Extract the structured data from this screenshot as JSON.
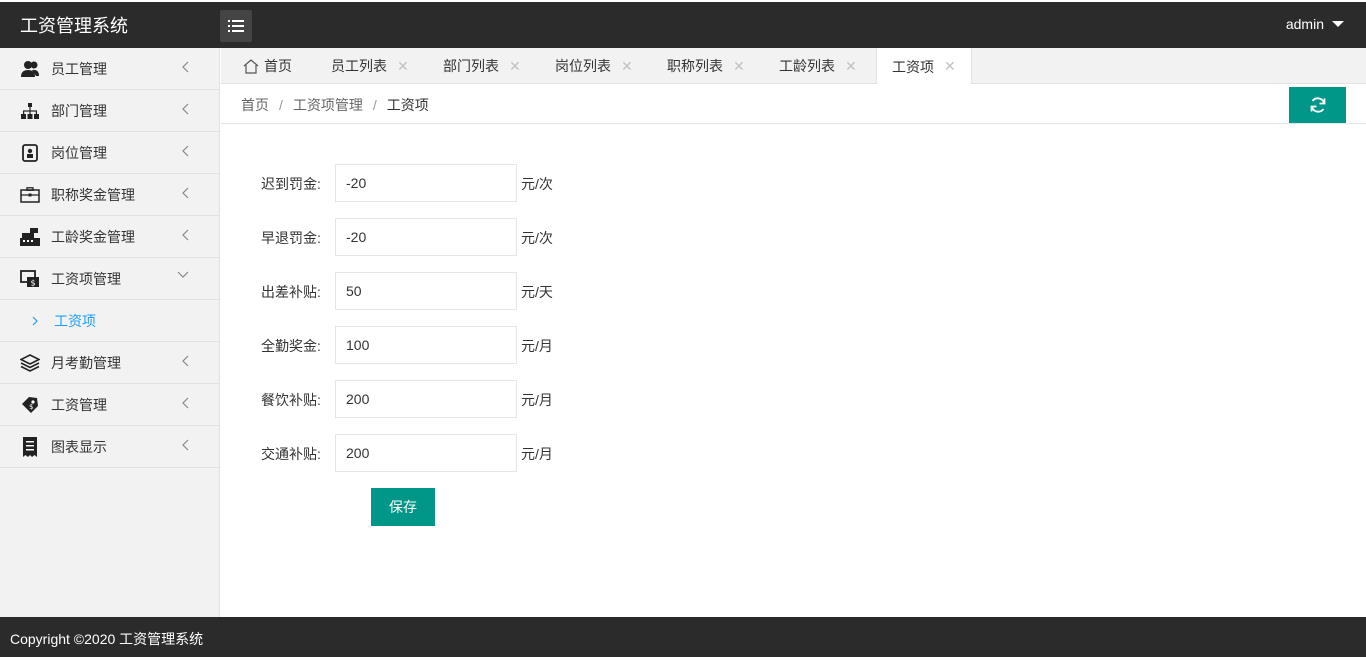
{
  "app": {
    "title": "工资管理系统",
    "user": "admin"
  },
  "sidebar": {
    "items": [
      {
        "label": "员工管理",
        "icon": "users-icon"
      },
      {
        "label": "部门管理",
        "icon": "sitemap-icon"
      },
      {
        "label": "岗位管理",
        "icon": "badge-icon"
      },
      {
        "label": "职称奖金管理",
        "icon": "briefcase-icon"
      },
      {
        "label": "工龄奖金管理",
        "icon": "cash-register-icon"
      },
      {
        "label": "工资项管理",
        "icon": "money-window-icon",
        "expanded": true
      },
      {
        "label": "月考勤管理",
        "icon": "layers-icon"
      },
      {
        "label": "工资管理",
        "icon": "tag-icon"
      },
      {
        "label": "图表显示",
        "icon": "receipt-icon"
      }
    ],
    "sub_item": {
      "label": "工资项"
    }
  },
  "tabs": {
    "home": "首页",
    "items": [
      "员工列表",
      "部门列表",
      "岗位列表",
      "职称列表",
      "工龄列表",
      "工资项"
    ],
    "active_index": 5
  },
  "breadcrumb": {
    "items": [
      "首页",
      "工资项管理",
      "工资项"
    ]
  },
  "form": {
    "fields": [
      {
        "label": "迟到罚金:",
        "value": "-20",
        "unit": "元/次"
      },
      {
        "label": "早退罚金:",
        "value": "-20",
        "unit": "元/次"
      },
      {
        "label": "出差补贴:",
        "value": "50",
        "unit": "元/天"
      },
      {
        "label": "全勤奖金:",
        "value": "100",
        "unit": "元/月"
      },
      {
        "label": "餐饮补贴:",
        "value": "200",
        "unit": "元/月"
      },
      {
        "label": "交通补贴:",
        "value": "200",
        "unit": "元/月"
      }
    ],
    "save_label": "保存"
  },
  "footer": {
    "text": "Copyright ©2020 工资管理系统"
  },
  "colors": {
    "accent": "#009688",
    "header": "#2b2b2b",
    "link": "#1e9fff"
  }
}
